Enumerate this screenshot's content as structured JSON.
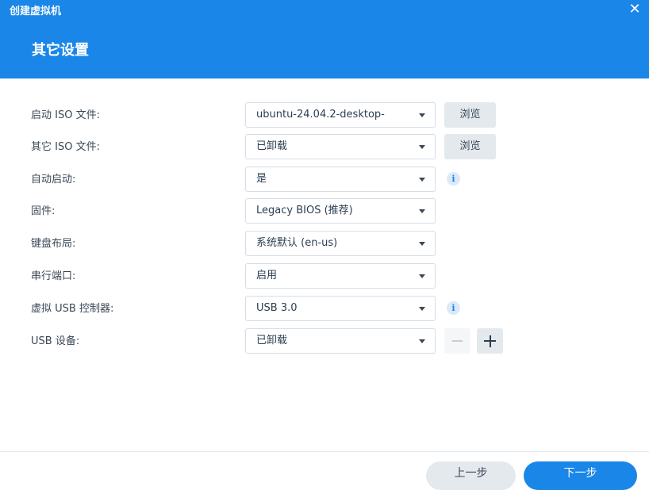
{
  "window": {
    "title": "创建虚拟机",
    "close_glyph": "✕"
  },
  "section_title": "其它设置",
  "fields": [
    {
      "label": "启动 ISO 文件:",
      "value": "ubuntu-24.04.2-desktop-",
      "extra": "browse",
      "extra_label": "浏览"
    },
    {
      "label": "其它 ISO 文件:",
      "value": "已卸载",
      "extra": "browse",
      "extra_label": "浏览"
    },
    {
      "label": "自动启动:",
      "value": "是",
      "extra": "info",
      "extra_label": "i"
    },
    {
      "label": "固件:",
      "value": "Legacy BIOS (推荐)"
    },
    {
      "label": "键盘布局:",
      "value": "系统默认 (en-us)"
    },
    {
      "label": "串行端口:",
      "value": "启用"
    },
    {
      "label": "虚拟 USB 控制器:",
      "value": "USB 3.0",
      "extra": "info",
      "extra_label": "i"
    },
    {
      "label": "USB 设备:",
      "value": "已卸载",
      "extra": "add-remove"
    }
  ],
  "footer": {
    "prev_label": "上一步",
    "next_label": "下一步"
  },
  "colors": {
    "accent": "#1a86e8",
    "secondary_button": "#e4e9ee"
  },
  "icons": [
    "close-icon",
    "chevron-down-icon",
    "info-icon",
    "minus-icon",
    "plus-icon"
  ]
}
